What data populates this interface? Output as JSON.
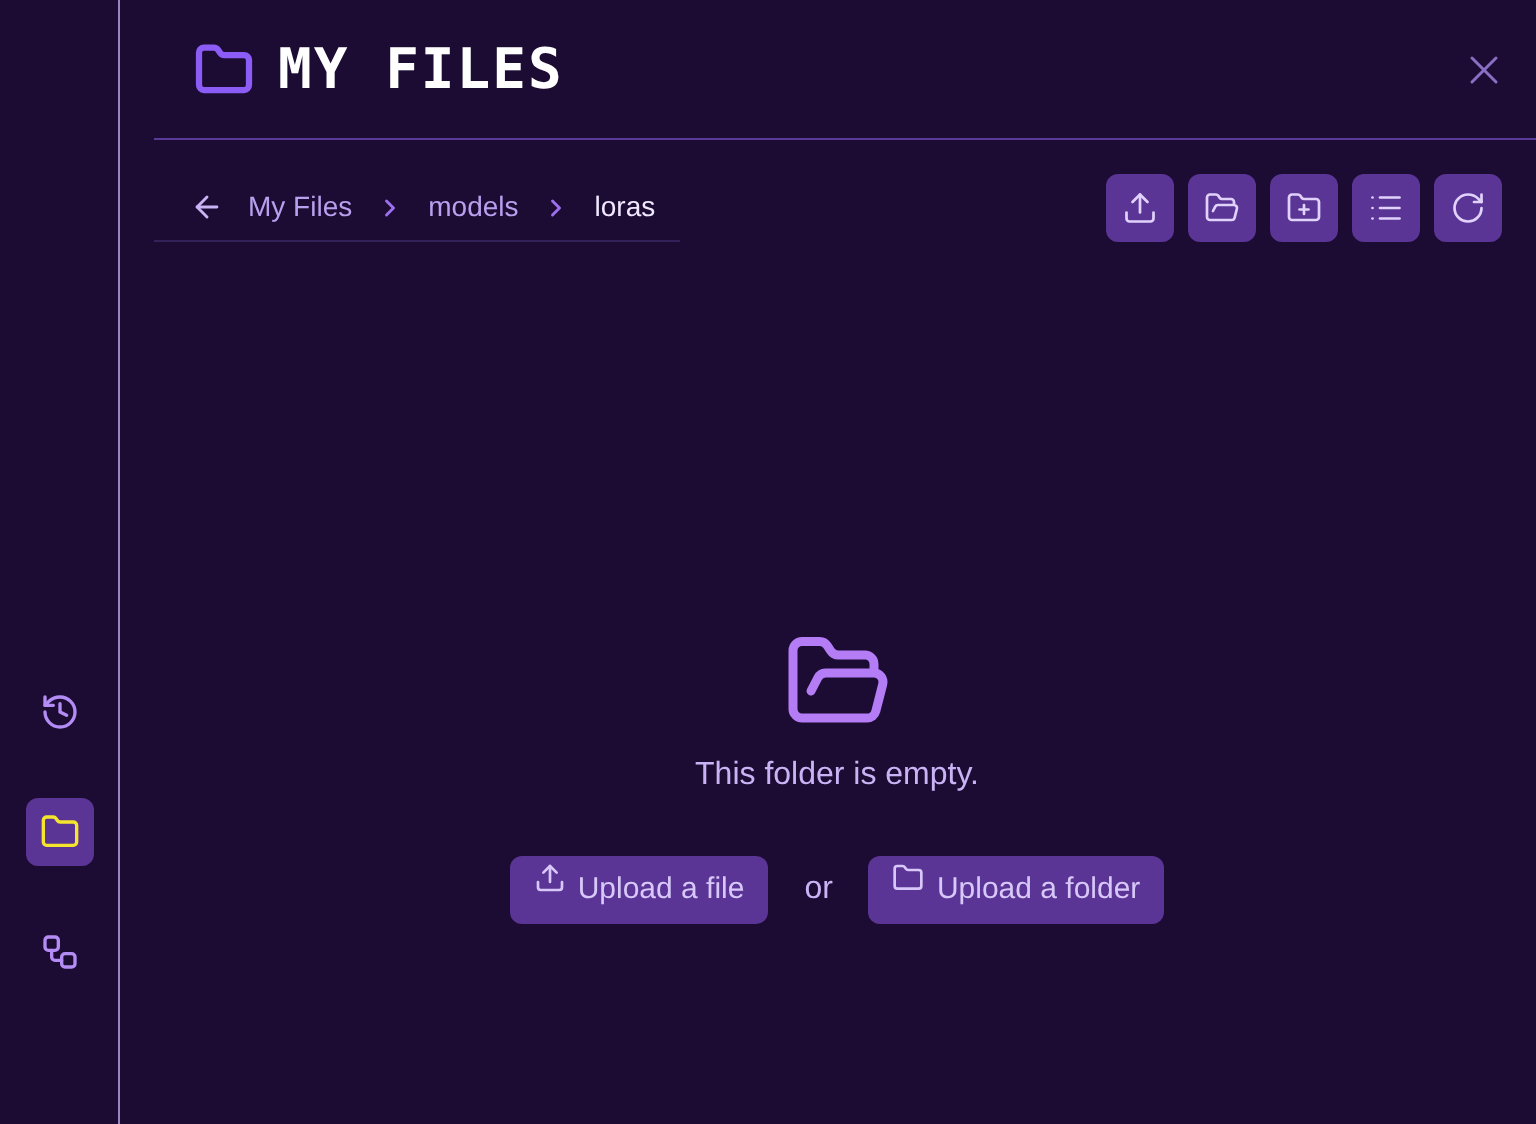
{
  "sidebar": {
    "items": [
      {
        "kind": "history",
        "selected": false
      },
      {
        "kind": "files",
        "selected": true
      },
      {
        "kind": "workflow",
        "selected": false
      }
    ]
  },
  "header": {
    "title": "MY FILES"
  },
  "breadcrumb": [
    "My Files",
    "models",
    "loras"
  ],
  "empty_state": {
    "message": "This folder is empty.",
    "upload_file": "Upload a file",
    "separator": "or",
    "upload_folder": "Upload a folder"
  }
}
